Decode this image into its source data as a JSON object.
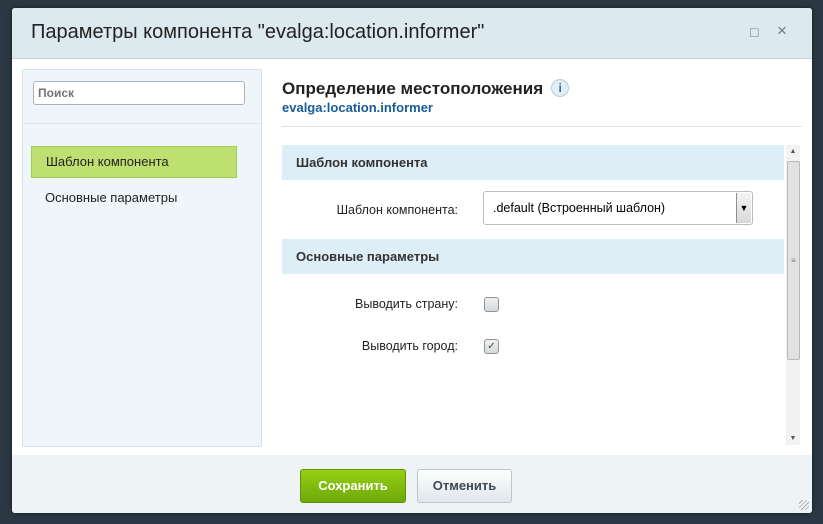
{
  "dialog": {
    "title": "Параметры компонента \"evalga:location.informer\"",
    "maximize_icon": "□",
    "close_icon": "×"
  },
  "sidebar": {
    "search_placeholder": "Поиск",
    "items": [
      {
        "label": "Шаблон компонента",
        "active": true
      },
      {
        "label": "Основные параметры",
        "active": false
      }
    ]
  },
  "main": {
    "heading": "Определение местоположения",
    "info_icon": "i",
    "component_id": "evalga:location.informer",
    "sections": [
      {
        "title": "Шаблон компонента",
        "fields": [
          {
            "label": "Шаблон компонента:",
            "value": ".default (Встроенный шаблон)"
          }
        ]
      },
      {
        "title": "Основные параметры",
        "fields": [
          {
            "label": "Выводить страну:",
            "checked": false
          },
          {
            "label": "Выводить город:",
            "checked": true
          }
        ]
      }
    ]
  },
  "footer": {
    "save_label": "Сохранить",
    "cancel_label": "Отменить"
  },
  "colors": {
    "save": "#7dbb0e",
    "section_bg": "#ddeef6",
    "active_item": "#bee070",
    "link": "#1a5c96"
  }
}
